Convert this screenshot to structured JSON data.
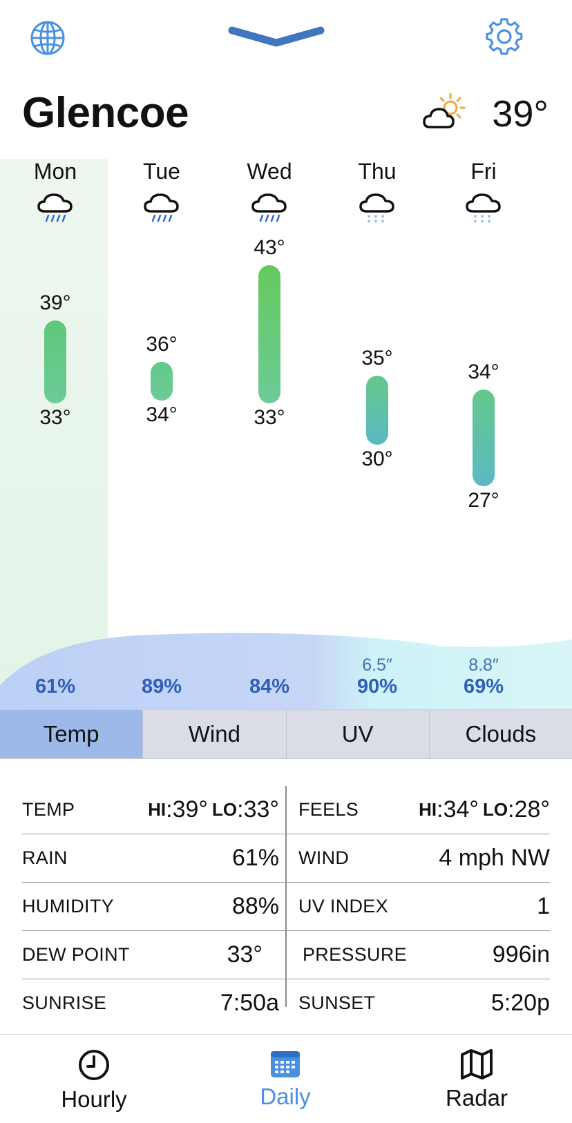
{
  "header": {
    "city": "Glencoe",
    "current_temp": "39°",
    "icons": {
      "left": "globe-icon",
      "center": "chevron-down-icon",
      "right": "gear-icon",
      "current": "partly-sunny-cloud-icon"
    },
    "accent_color": "#4a90e2"
  },
  "days": [
    {
      "name": "Mon",
      "icon": "rain-cloud-icon",
      "hi": "39°",
      "lo": "33°",
      "hi_value": 39,
      "lo_value": 33,
      "precip_pct": "61%",
      "snow": ""
    },
    {
      "name": "Tue",
      "icon": "rain-cloud-icon",
      "hi": "36°",
      "lo": "34°",
      "hi_value": 36,
      "lo_value": 34,
      "precip_pct": "89%",
      "snow": ""
    },
    {
      "name": "Wed",
      "icon": "rain-cloud-icon",
      "hi": "43°",
      "lo": "33°",
      "hi_value": 43,
      "lo_value": 33,
      "precip_pct": "84%",
      "snow": ""
    },
    {
      "name": "Thu",
      "icon": "snow-cloud-icon",
      "hi": "35°",
      "lo": "30°",
      "hi_value": 35,
      "lo_value": 30,
      "precip_pct": "90%",
      "snow": "6.5″"
    },
    {
      "name": "Fri",
      "icon": "snow-cloud-icon",
      "hi": "34°",
      "lo": "27°",
      "hi_value": 34,
      "lo_value": 27,
      "precip_pct": "69%",
      "snow": "8.8″"
    }
  ],
  "tabs": [
    "Temp",
    "Wind",
    "UV",
    "Clouds"
  ],
  "active_tab": "Temp",
  "details": {
    "temp_label": "TEMP",
    "temp_hi_prefix": "HI",
    "temp_hi": ":39°",
    "temp_lo_prefix": "LO",
    "temp_lo": ":33°",
    "feels_label": "FEELS",
    "feels_hi_prefix": "HI",
    "feels_hi": ":34°",
    "feels_lo_prefix": "LO",
    "feels_lo": ":28°",
    "rain_label": "RAIN",
    "rain_value": "61%",
    "wind_label": "WIND",
    "wind_value": "4 mph NW",
    "humidity_label": "HUMIDITY",
    "humidity_value": "88%",
    "uv_label": "UV INDEX",
    "uv_value": "1",
    "dew_label": "DEW POINT",
    "dew_value": "33°",
    "pressure_label": "PRESSURE",
    "pressure_value": "996in",
    "sunrise_label": "SUNRISE",
    "sunrise_value": "7:50a",
    "sunset_label": "SUNSET",
    "sunset_value": "5:20p"
  },
  "bottom_nav": {
    "hourly": "Hourly",
    "daily": "Daily",
    "radar": "Radar",
    "icons": {
      "hourly": "clock-icon",
      "daily": "calendar-icon",
      "radar": "map-icon"
    },
    "active": "Daily"
  }
}
